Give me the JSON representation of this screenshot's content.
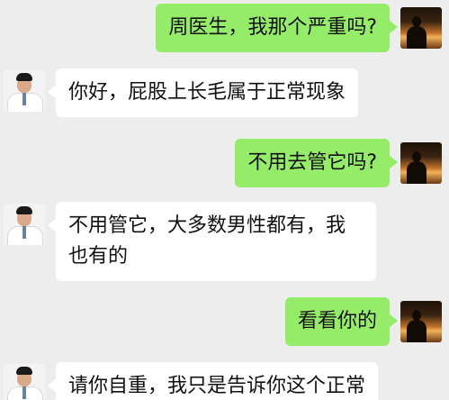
{
  "conversation": {
    "messages": [
      {
        "sender": "user",
        "text": "周医生，我那个严重吗?"
      },
      {
        "sender": "doctor",
        "text": "你好，屁股上长毛属于正常现象"
      },
      {
        "sender": "user",
        "text": "不用去管它吗?"
      },
      {
        "sender": "doctor",
        "text": "不用管它，大多数男性都有，我也有的"
      },
      {
        "sender": "user",
        "text": "看看你的"
      },
      {
        "sender": "doctor",
        "text": "请你自重，我只是告诉你这个正常"
      }
    ]
  },
  "colors": {
    "background": "#ededed",
    "outgoing_bubble": "#95ec69",
    "incoming_bubble": "#ffffff"
  },
  "icons": {
    "user_avatar": "sunset-silhouette-avatar",
    "doctor_avatar": "doctor-portrait-avatar"
  }
}
